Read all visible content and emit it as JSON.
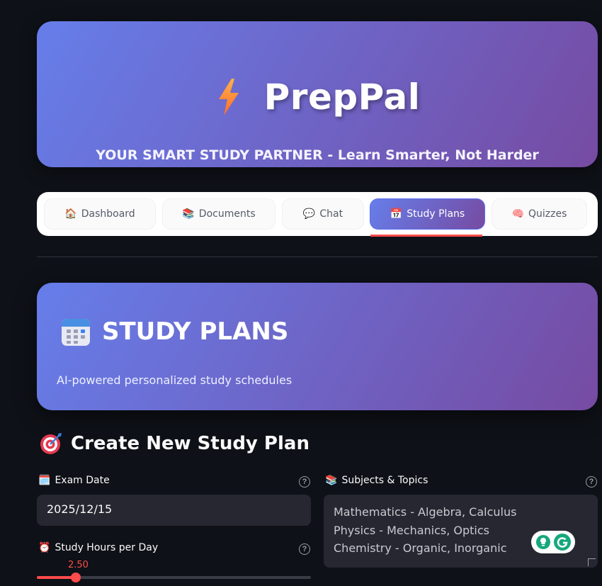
{
  "app": {
    "title": "PrepPal",
    "subtitle": "YOUR SMART STUDY PARTNER - Learn Smarter, Not Harder"
  },
  "tabs": [
    {
      "label": "Dashboard",
      "icon": "🏠",
      "active": false
    },
    {
      "label": "Documents",
      "icon": "📚",
      "active": false
    },
    {
      "label": "Chat",
      "icon": "💬",
      "active": false
    },
    {
      "label": "Study Plans",
      "icon": "📅",
      "active": true
    },
    {
      "label": "Quizzes",
      "icon": "🧠",
      "active": false
    }
  ],
  "banner": {
    "title": "STUDY PLANS",
    "subtitle": "AI-powered personalized study schedules"
  },
  "section": {
    "icon": "🎯",
    "title": "Create New Study Plan"
  },
  "form": {
    "exam_date": {
      "icon": "🗓️",
      "label": "Exam Date",
      "value": "2025/12/15"
    },
    "hours": {
      "icon": "⏰",
      "label": "Study Hours per Day",
      "value": "2.50",
      "fraction": 0.143
    },
    "subjects": {
      "icon": "📚",
      "label": "Subjects & Topics",
      "lines": [
        "Mathematics - Algebra, Calculus",
        "Physics - Mechanics, Optics",
        "Chemistry - Organic, Inorganic"
      ]
    }
  },
  "colors": {
    "accent": "#ff4b4b",
    "gradient_start": "#667eea",
    "gradient_end": "#764ba2",
    "background": "#0e1117",
    "input_bg": "#262730"
  }
}
